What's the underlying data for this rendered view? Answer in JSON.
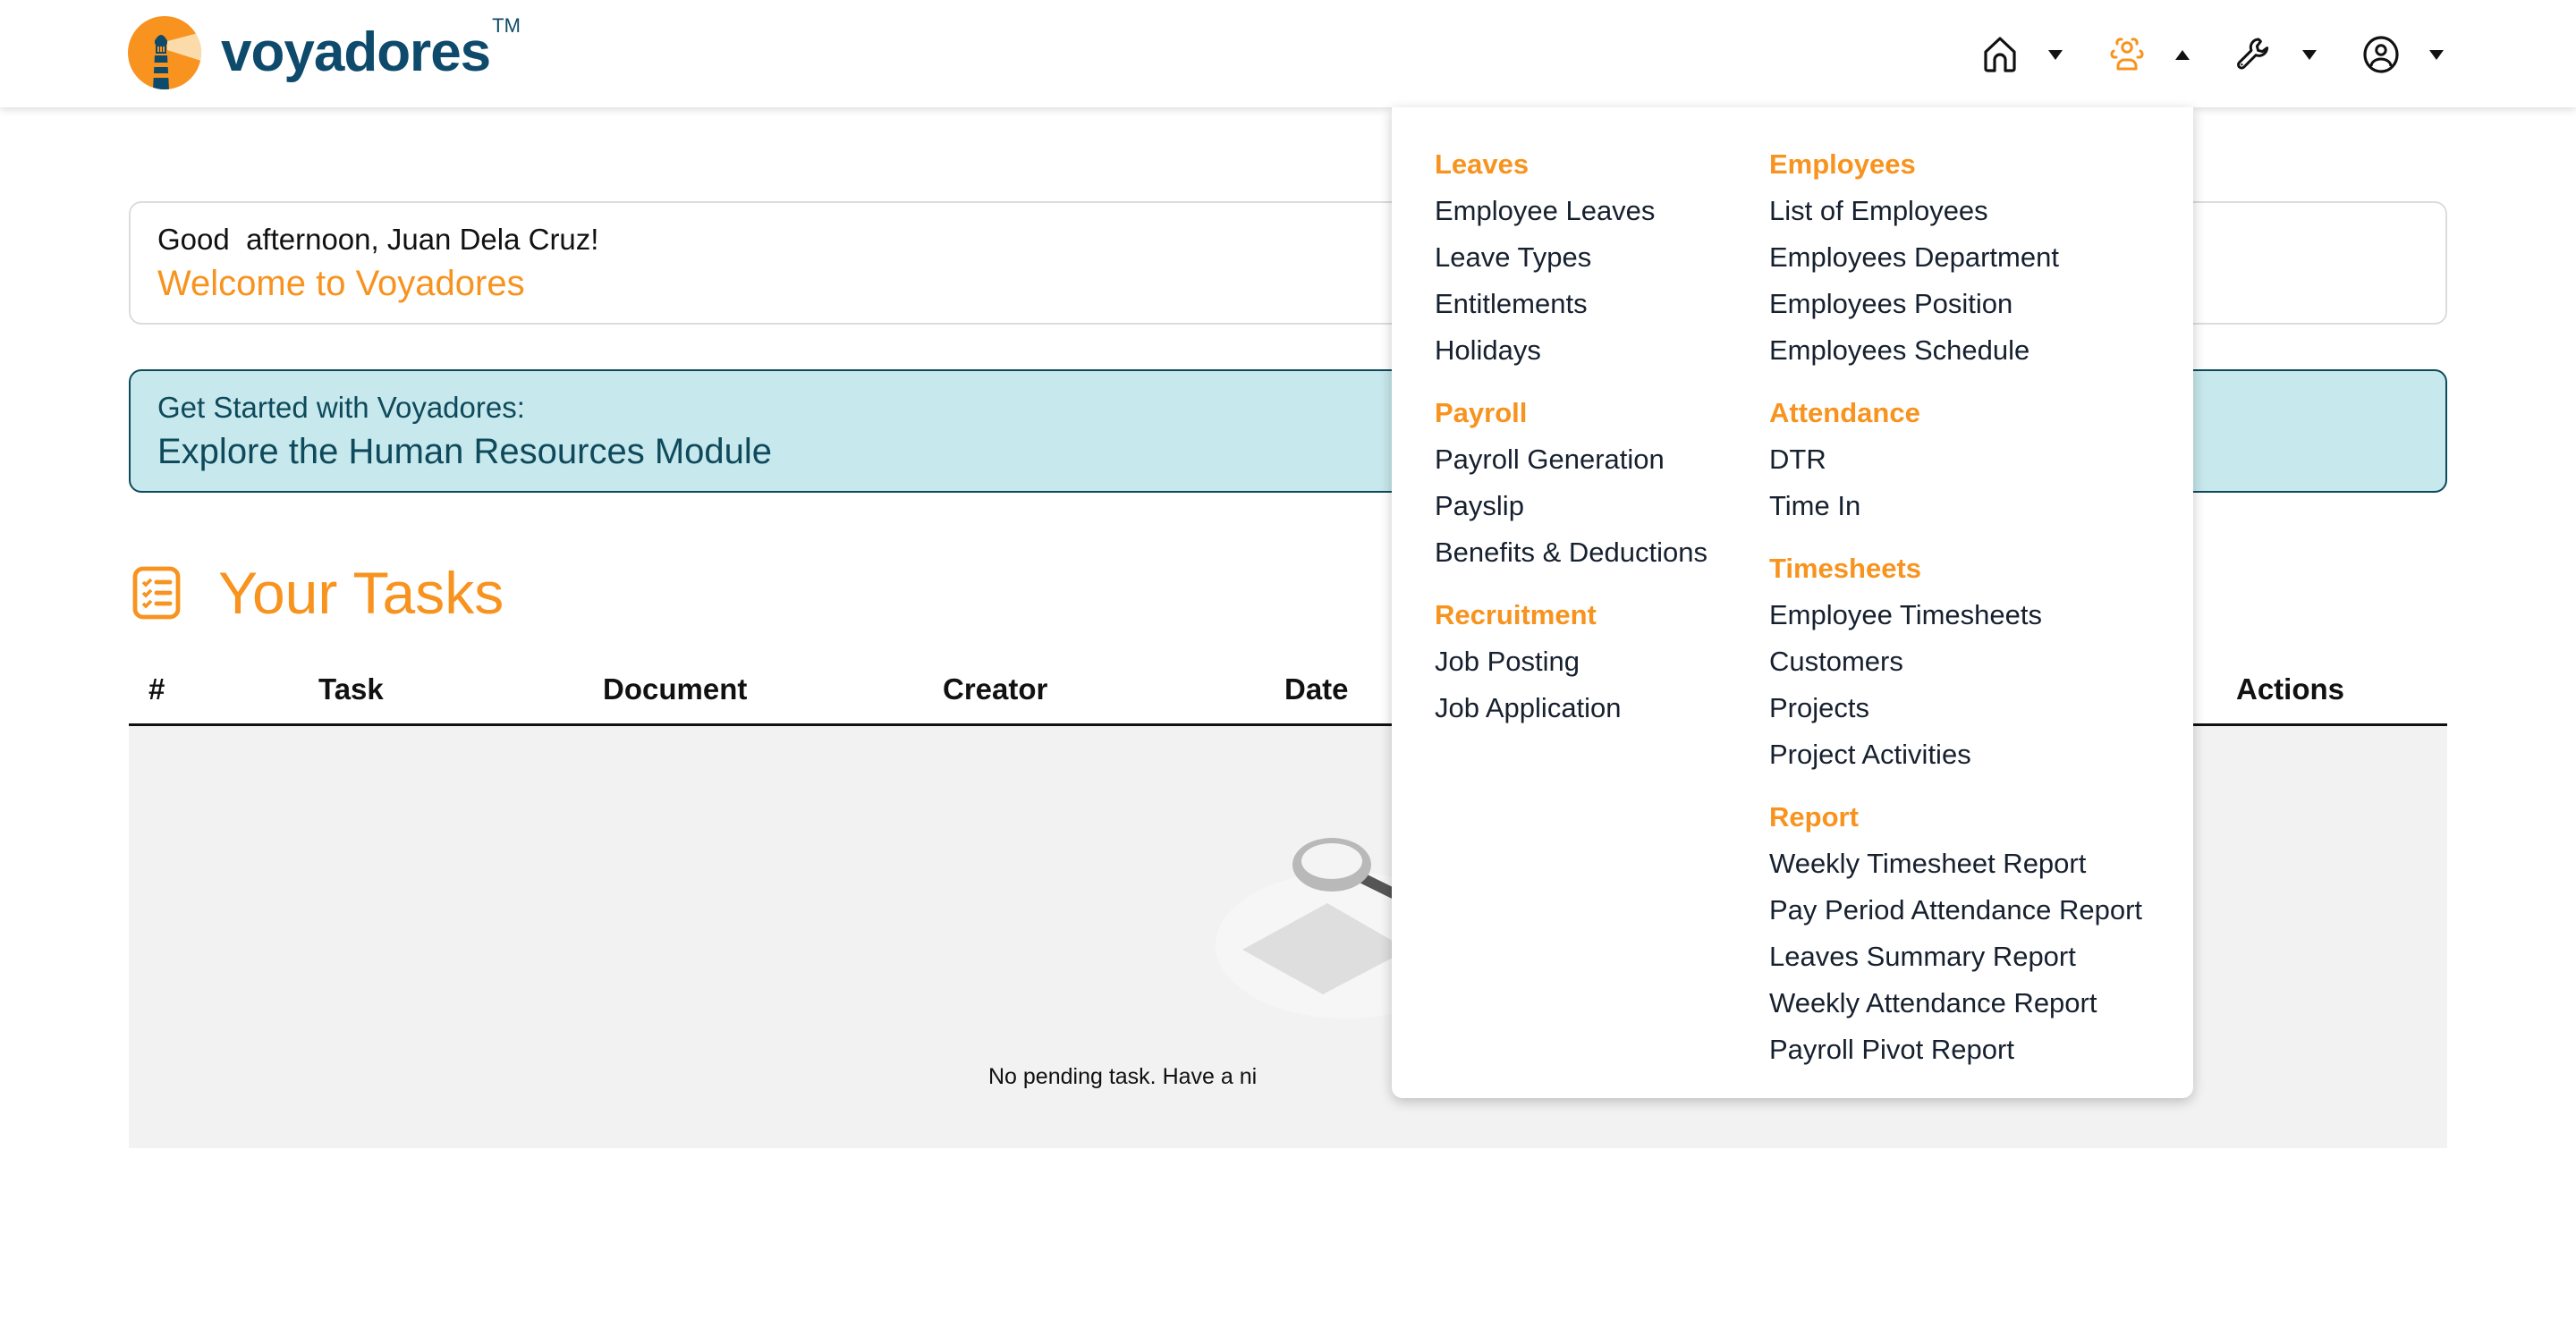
{
  "brand": {
    "name": "voyadores",
    "trademark": "TM",
    "colors": {
      "primary": "#f7931e",
      "navy": "#0d4a6b",
      "teal_border": "#0e4a5c",
      "banner_bg": "#c7e8ec",
      "table_body_bg": "#f2f2f2"
    }
  },
  "nav": {
    "items": [
      {
        "icon": "home-icon",
        "caret": "down",
        "active": false
      },
      {
        "icon": "users-group-icon",
        "caret": "up",
        "active": true
      },
      {
        "icon": "wrench-icon",
        "caret": "down",
        "active": false
      },
      {
        "icon": "user-circle-icon",
        "caret": "down",
        "active": false
      }
    ]
  },
  "greeting": {
    "line": "Good  afternoon, Juan Dela Cruz!",
    "welcome": "Welcome to Voyadores"
  },
  "banner": {
    "subtitle": "Get Started with Voyadores:",
    "title": "Explore the Human Resources Module"
  },
  "tasks": {
    "title": "Your Tasks",
    "columns": [
      "#",
      "Task",
      "Document",
      "Creator",
      "Date",
      "Actions"
    ],
    "empty_message": "No pending task. Have a ni"
  },
  "dropdown": {
    "columns": [
      [
        {
          "heading": "Leaves",
          "links": [
            "Employee Leaves",
            "Leave Types",
            "Entitlements",
            "Holidays"
          ]
        },
        {
          "heading": "Payroll",
          "links": [
            "Payroll Generation",
            "Payslip",
            "Benefits & Deductions"
          ]
        },
        {
          "heading": "Recruitment",
          "links": [
            "Job Posting",
            "Job Application"
          ]
        }
      ],
      [
        {
          "heading": "Employees",
          "links": [
            "List of Employees",
            "Employees Department",
            "Employees Position",
            "Employees Schedule"
          ]
        },
        {
          "heading": "Attendance",
          "links": [
            "DTR",
            "Time In"
          ]
        },
        {
          "heading": "Timesheets",
          "links": [
            "Employee Timesheets",
            "Customers",
            "Projects",
            "Project Activities"
          ]
        },
        {
          "heading": "Report",
          "links": [
            "Weekly Timesheet Report",
            "Pay Period Attendance Report",
            "Leaves Summary Report",
            "Weekly Attendance Report",
            "Payroll Pivot Report"
          ]
        }
      ]
    ]
  }
}
